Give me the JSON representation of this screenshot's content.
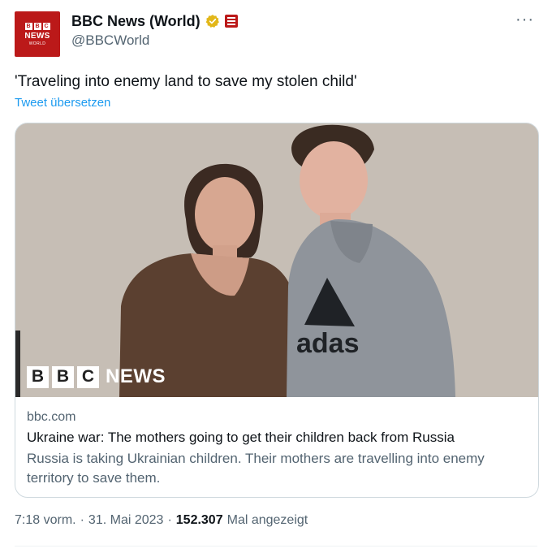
{
  "account": {
    "display_name": "BBC News (World)",
    "handle": "@BBCWorld",
    "avatar": {
      "logo_letters": [
        "B",
        "B",
        "C"
      ],
      "word": "NEWS",
      "sub": "WORLD"
    }
  },
  "tweet": {
    "text": "'Traveling into enemy land to save my stolen child'",
    "translate_label": "Tweet übersetzen"
  },
  "card": {
    "logo_letters": [
      "B",
      "B",
      "C"
    ],
    "logo_word": "NEWS",
    "domain": "bbc.com",
    "title": "Ukraine war: The mothers going to get their children back from Russia",
    "description": "Russia is taking Ukrainian children. Their mothers are travelling into enemy territory to save them."
  },
  "meta": {
    "time": "7:18 vorm.",
    "separator": "·",
    "date": "31. Mai 2023",
    "views_count": "152.307",
    "views_label": "Mal angezeigt"
  },
  "icons": {
    "verified": "verified-badge-icon",
    "affiliate": "affiliate-badge-icon",
    "more": "more-icon"
  },
  "colors": {
    "brand_red": "#bb1919",
    "verified_gold": "#e2b719",
    "link_blue": "#1d9bf0",
    "secondary_text": "#536471"
  }
}
